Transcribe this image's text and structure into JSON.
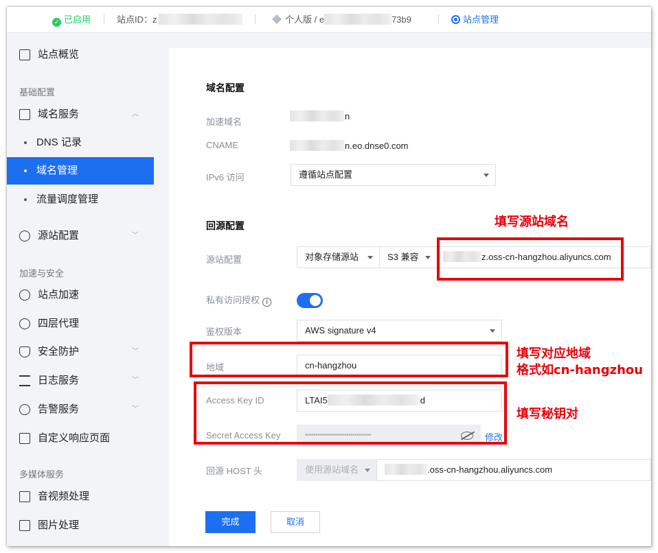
{
  "topbar": {
    "status": "已启用",
    "site_id_label": "站点ID：z",
    "plan_prefix": "个人版 / e",
    "plan_suffix": "73b9",
    "site_manage": "站点管理"
  },
  "sidebar": {
    "overview": "站点概览",
    "group_basic": "基础配置",
    "domain_service": "域名服务",
    "dns_records": "DNS 记录",
    "domain_manage": "域名管理",
    "traffic_manage": "流量调度管理",
    "origin_config": "源站配置",
    "group_accel": "加速与安全",
    "site_accel": "站点加速",
    "l4_proxy": "四层代理",
    "security": "安全防护",
    "log_service": "日志服务",
    "alert_service": "告警服务",
    "custom_page": "自定义响应页面",
    "group_media": "多媒体服务",
    "av_processing": "音视频处理",
    "image_processing": "图片处理"
  },
  "domain_config": {
    "title": "域名配置",
    "accel_domain_label": "加速域名",
    "accel_domain_value": "n",
    "cname_label": "CNAME",
    "cname_value": "n.eo.dnse0.com",
    "ipv6_label": "IPv6 访问",
    "ipv6_value": "遵循站点配置"
  },
  "origin": {
    "title": "回源配置",
    "origin_label": "源站配置",
    "origin_type": "对象存储源站",
    "compat": "S3 兼容",
    "origin_host": "z.oss-cn-hangzhou.aliyuncs.com",
    "private_auth_label": "私有访问授权",
    "auth_version_label": "鉴权版本",
    "auth_version_value": "AWS signature v4",
    "region_label": "地域",
    "region_value": "cn-hangzhou",
    "ak_id_label": "Access Key ID",
    "ak_id_prefix": "LTAI5",
    "ak_id_suffix": "d",
    "secret_label": "Secret Access Key",
    "secret_value": "••••••••••••••••••••••••••••••••",
    "modify": "修改",
    "host_header_label": "回源 HOST 头",
    "host_header_mode": "使用源站域名",
    "host_header_value": ".oss-cn-hangzhou.aliyuncs.com"
  },
  "actions": {
    "done": "完成",
    "cancel": "取消"
  },
  "annotations": {
    "fill_origin": "填写源站域名",
    "fill_region_1": "填写对应地域",
    "fill_region_2": "格式如cn-hangzhou",
    "fill_keys": "填写秘钥对"
  },
  "colors": {
    "primary": "#1d6ff2",
    "annotation": "#e8000b",
    "success": "#29cc6a"
  }
}
